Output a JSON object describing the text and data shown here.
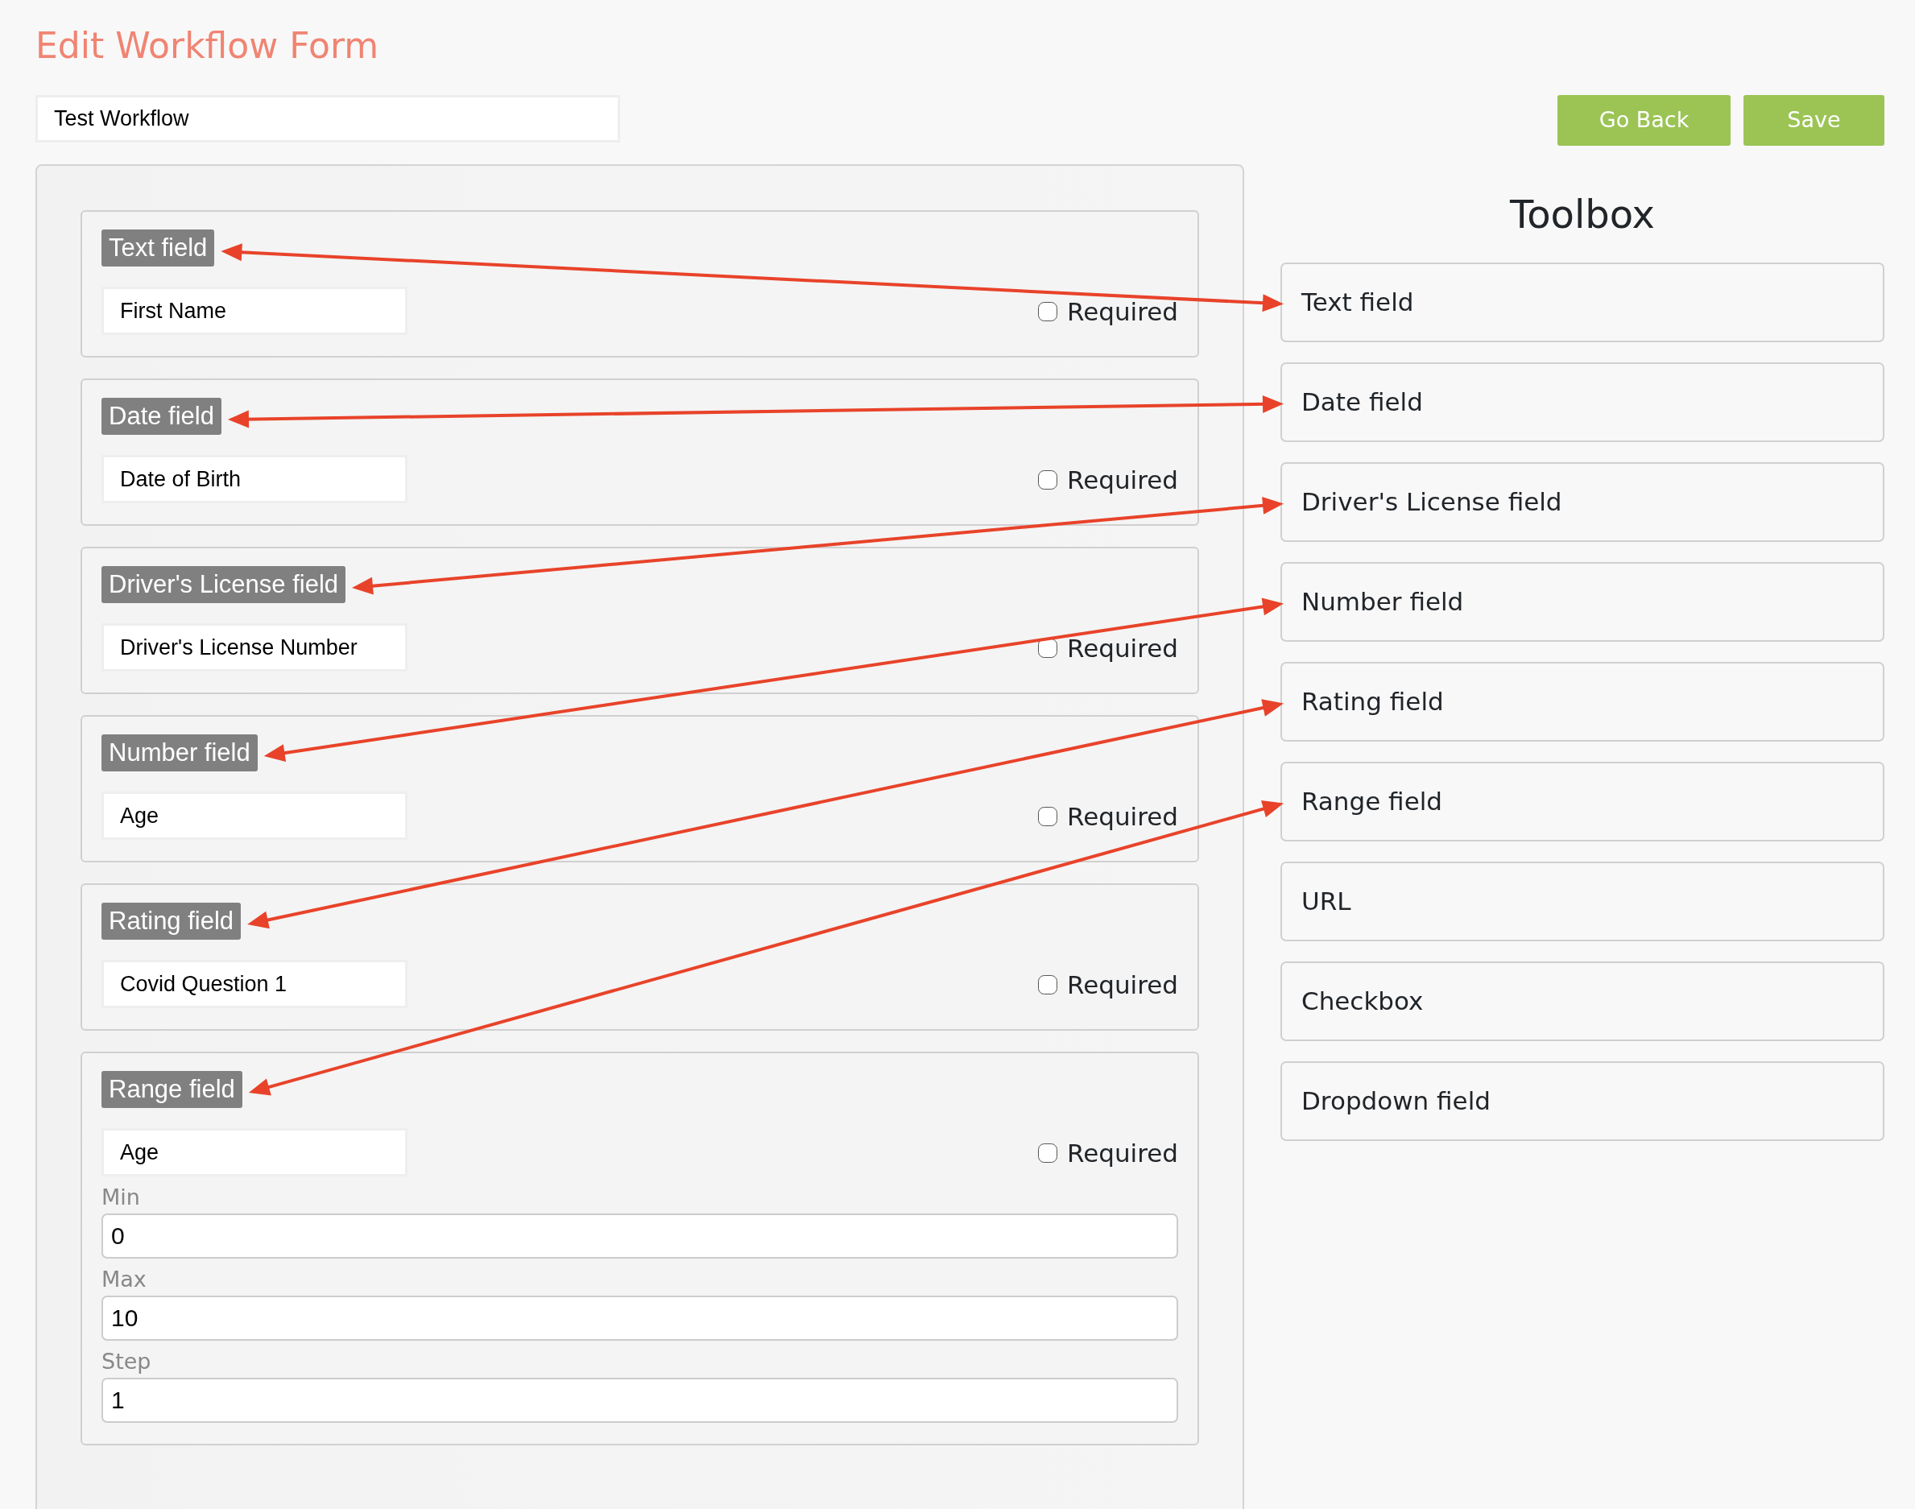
{
  "title": "Edit Workflow Form",
  "workflow_name": {
    "value": "Test Workflow"
  },
  "buttons": [
    {
      "label": "Go Back"
    },
    {
      "label": "Save"
    }
  ],
  "form_fields": [
    {
      "kind": "text",
      "type_label": "Text field",
      "name": "First Name",
      "required": false,
      "required_label": "Required",
      "annotated": true
    },
    {
      "kind": "text",
      "type_label": "Date field",
      "name": "Date of Birth",
      "required": false,
      "required_label": "Required",
      "annotated": true
    },
    {
      "kind": "text",
      "type_label": "Driver's License field",
      "name": "Driver's License Number",
      "required": false,
      "required_label": "Required",
      "annotated": true
    },
    {
      "kind": "text",
      "type_label": "Number field",
      "name": "Age",
      "required": false,
      "required_label": "Required",
      "annotated": true
    },
    {
      "kind": "text",
      "type_label": "Rating field",
      "name": "Covid Question 1",
      "required": false,
      "required_label": "Required",
      "annotated": true
    },
    {
      "kind": "range",
      "type_label": "Range field",
      "name": "Age",
      "required": false,
      "required_label": "Required",
      "annotated": true,
      "settings": [
        {
          "label": "Min",
          "value": "0"
        },
        {
          "label": "Max",
          "value": "10"
        },
        {
          "label": "Step",
          "value": "1"
        }
      ]
    }
  ],
  "toolbox": {
    "title": "Toolbox",
    "items": [
      {
        "label": "Text field"
      },
      {
        "label": "Date field"
      },
      {
        "label": "Driver's License field"
      },
      {
        "label": "Number field"
      },
      {
        "label": "Rating field"
      },
      {
        "label": "Range field"
      },
      {
        "label": "URL"
      },
      {
        "label": "Checkbox"
      },
      {
        "label": "Dropdown field"
      }
    ]
  }
}
